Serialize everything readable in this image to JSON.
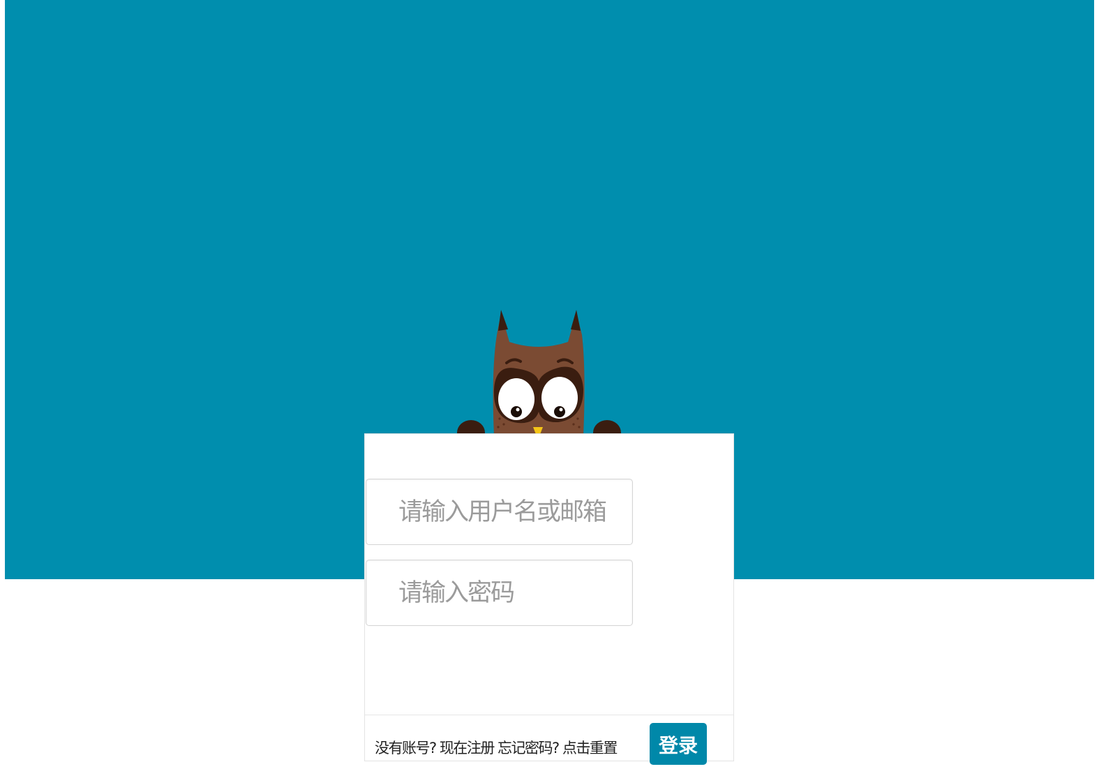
{
  "colors": {
    "hero_background": "#008eae",
    "button_background": "#0088a9",
    "card_background": "#ffffff",
    "owl_body": "#7b4b33",
    "owl_dark": "#3a1d10"
  },
  "owl": {
    "icon": "owl-mascot-icon"
  },
  "form": {
    "username_placeholder": "请输入用户名或邮箱",
    "password_placeholder": "请输入密码"
  },
  "footer": {
    "no_account_text": "没有账号?",
    "register_link": "现在注册",
    "forgot_text": "忘记密码?",
    "reset_link": "点击重置",
    "login_button": "登录"
  }
}
